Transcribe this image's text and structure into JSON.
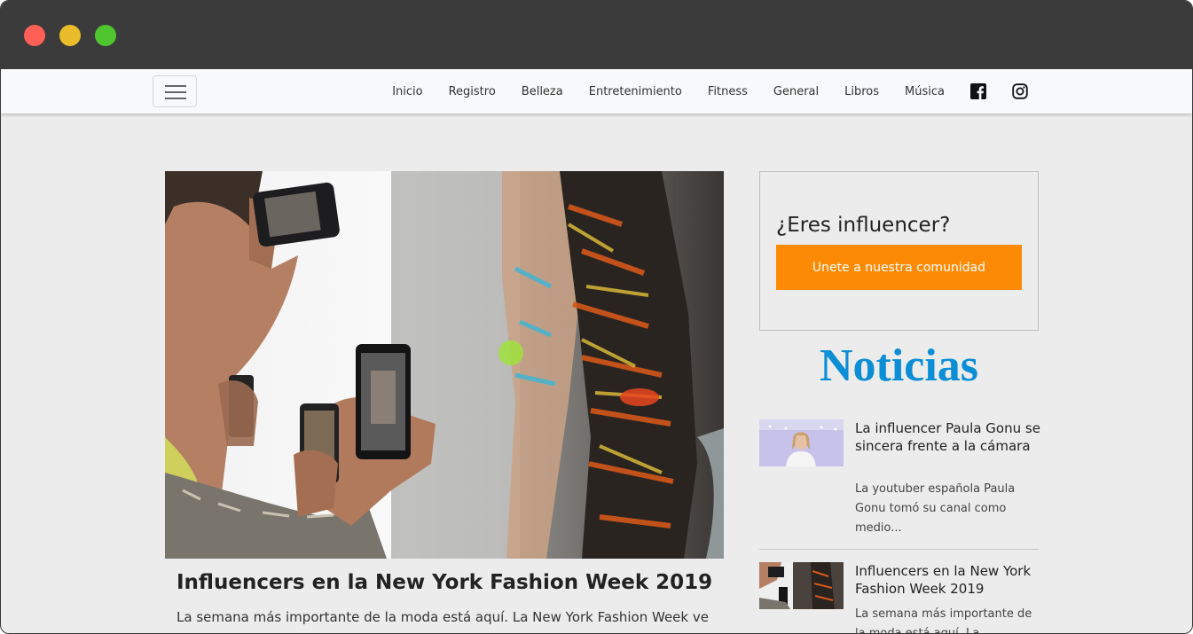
{
  "nav": {
    "links": [
      "Inicio",
      "Registro",
      "Belleza",
      "Entretenimiento",
      "Fitness",
      "General",
      "Libros",
      "Música"
    ],
    "social": [
      "facebook-icon",
      "instagram-icon"
    ]
  },
  "main_post": {
    "title": "Influencers en la New York Fashion Week 2019",
    "excerpt": "La semana más importante de la moda está aquí. La New York Fashion Week ve"
  },
  "sidebar": {
    "influencer_heading": "¿Eres influencer?",
    "cta_label": "Unete a nuestra comunidad",
    "news_heading": "Noticias",
    "news": [
      {
        "title": "La influencer Paula Gonu se sincera frente a la cámara",
        "excerpt": "La youtuber española Paula Gonu tomó su canal como medio..."
      },
      {
        "title": "Influencers en la New York Fashion Week 2019",
        "excerpt": "La semana más importante de la moda está aquí. La"
      }
    ]
  },
  "colors": {
    "accent_orange": "#fd8a05",
    "noticias_blue": "#0b8ed6",
    "titlebar": "#3b3b3b"
  }
}
